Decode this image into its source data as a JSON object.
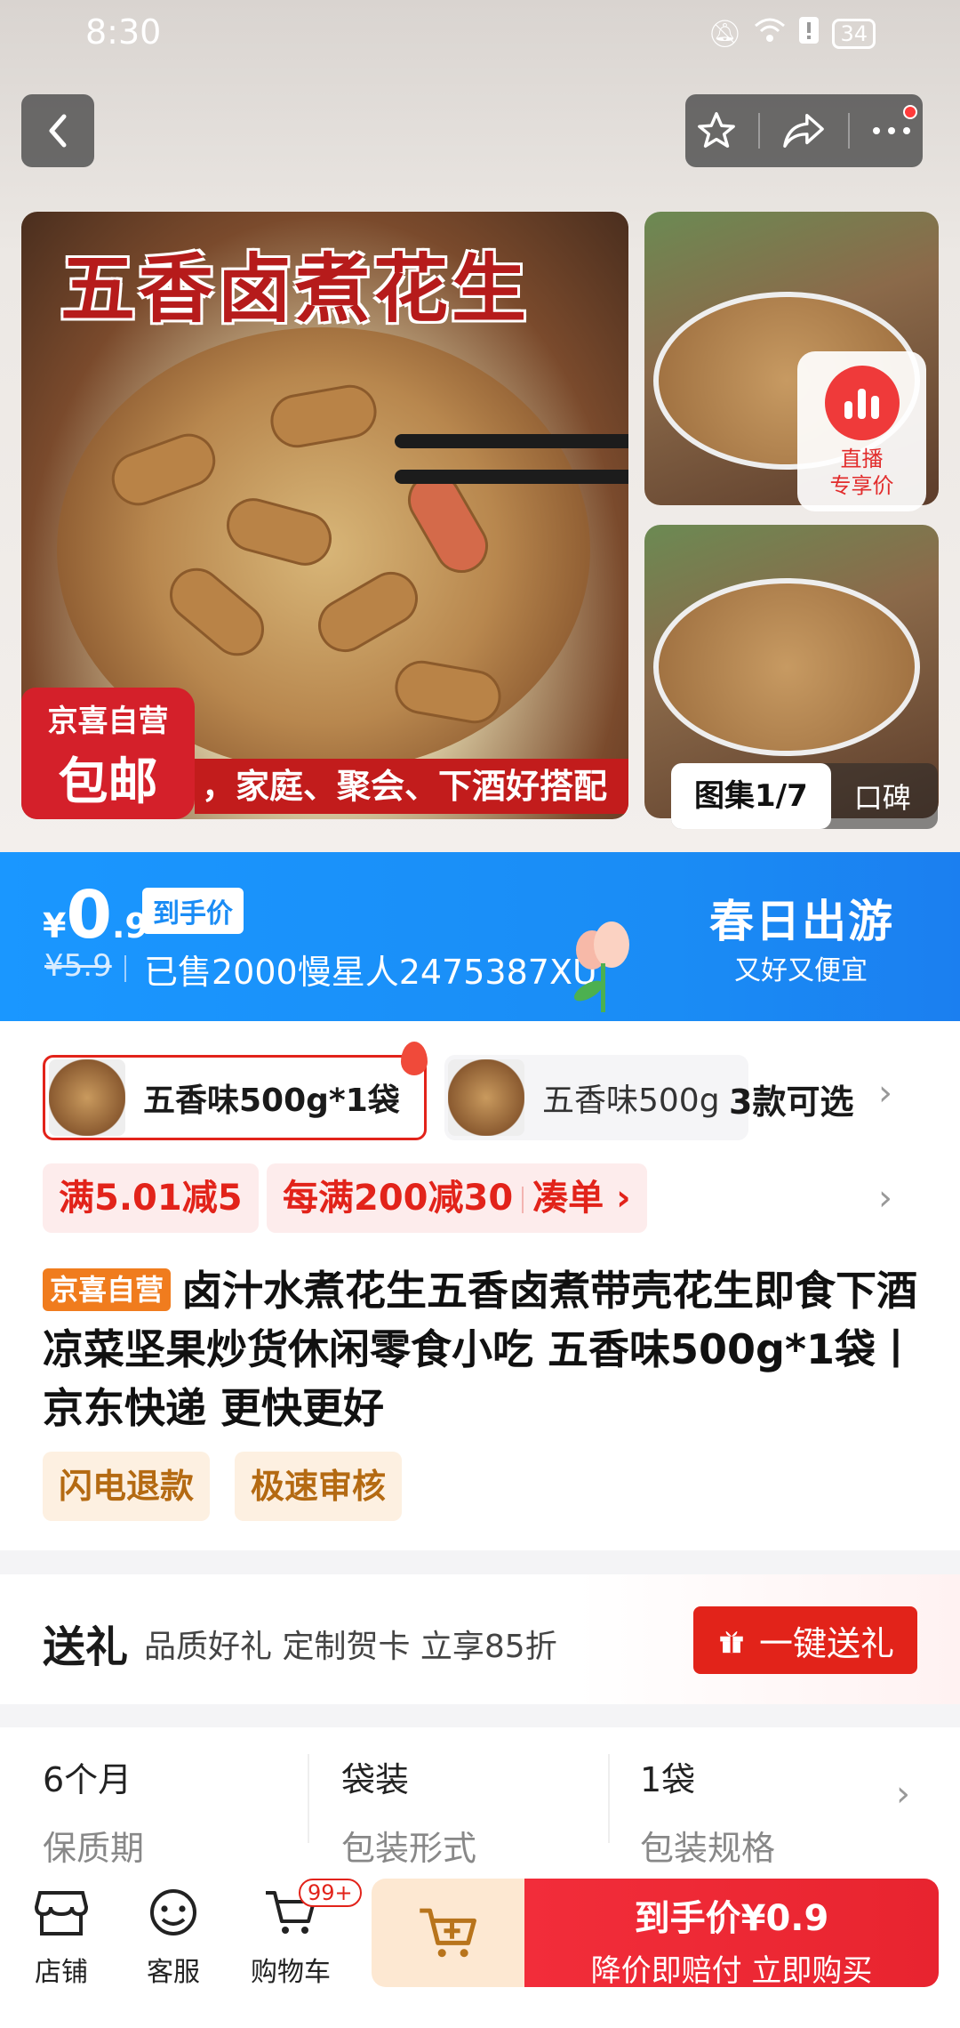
{
  "status": {
    "time": "8:30",
    "battery": "34"
  },
  "gallery": {
    "main_title": "五香卤煮花生",
    "self_badge_line1": "京喜自营",
    "self_badge_line2": "包邮",
    "main_caption": "，家庭、聚会、下酒好搭配",
    "live_line1": "直播",
    "live_line2": "专享价",
    "counter": "图集1/7",
    "review_tab": "口碑"
  },
  "price": {
    "currency": "¥",
    "integer": "0",
    "decimal": ".9",
    "tag": "到手价",
    "original": "¥5.9",
    "sold_text": "已售2000慢星人2475387XU",
    "promo_title": "春日出游",
    "promo_sub": "又好又便宜"
  },
  "variants": {
    "selected_label": "五香味500g*1袋",
    "other_label": "五香味500g",
    "count_text": "3款可选"
  },
  "coupons": {
    "c1": "满5.01减5",
    "c2": "每满200减30",
    "c2_action": "凑单"
  },
  "product": {
    "tag": "京喜自营",
    "title": "卤汁水煮花生五香卤煮带壳花生即食下酒凉菜坚果炒货休闲零食小吃 五香味500g*1袋丨京东快递 更快更好",
    "service1": "闪电退款",
    "service2": "极速审核"
  },
  "gift": {
    "title": "送礼",
    "subtitle": "品质好礼 定制贺卡 立享85折",
    "button": "一键送礼"
  },
  "specs": [
    {
      "value": "6个月",
      "key": "保质期"
    },
    {
      "value": "袋装",
      "key": "包装形式"
    },
    {
      "value": "1袋",
      "key": "包装规格"
    }
  ],
  "bottom_nav": {
    "shop": "店铺",
    "service": "客服",
    "cart": "购物车",
    "cart_badge": "99+",
    "buy_line1": "到手价¥0.9",
    "buy_line2": "降价即赔付 立即购买"
  },
  "colors": {
    "accent_red": "#e2231a",
    "banner_blue": "#1a8cf5",
    "tag_orange": "#f07c1e"
  }
}
